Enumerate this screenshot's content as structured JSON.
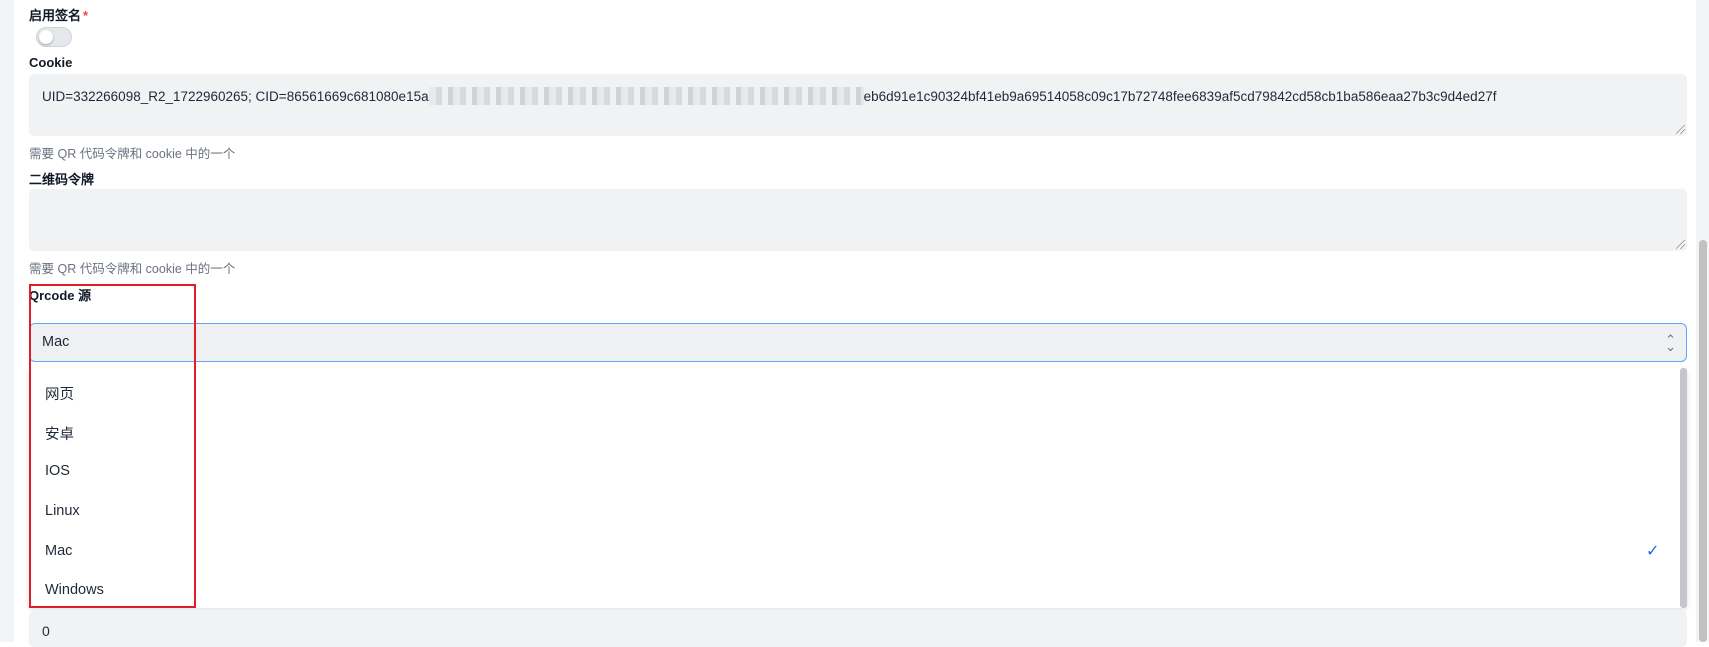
{
  "form": {
    "enable_signing": {
      "label": "启用签名",
      "required_mark": "*",
      "checked": false
    },
    "cookie": {
      "label": "Cookie",
      "value_prefix": "UID=332266098_R2_1722960265; CID=86561669c681080e15a",
      "value_suffix": "eb6d91e1c90324bf41eb9a69514058c09c17b72748fee6839af5cd79842cd58cb1ba586eaa27b3c9d4ed27f",
      "hint": "需要 QR 代码令牌和 cookie 中的一个"
    },
    "qr_token": {
      "label": "二维码令牌",
      "value": "",
      "hint": "需要 QR 代码令牌和 cookie 中的一个"
    },
    "qrcode_source": {
      "label": "Qrcode 源",
      "selected": "Mac",
      "options": [
        "网页",
        "安卓",
        "IOS",
        "Linux",
        "Mac",
        "Windows"
      ]
    },
    "next_field_value": "0"
  },
  "colors": {
    "accent": "#2563eb",
    "highlight_border": "#e11d2a",
    "focus_border": "#60a5fa",
    "required": "#ef4444"
  },
  "icons": {
    "select_chevron": "chevron-up-down-icon",
    "selected_check": "check-icon"
  }
}
